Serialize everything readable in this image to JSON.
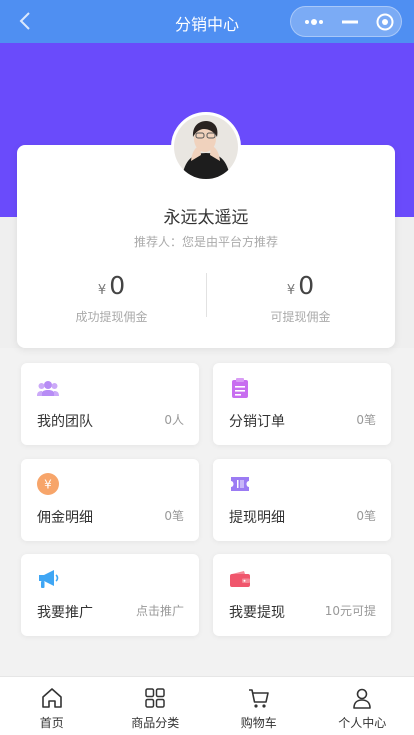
{
  "navbar": {
    "title": "分销中心"
  },
  "profile": {
    "name": "永远太遥远",
    "referrer": "推荐人：您是由平台方推荐",
    "currency": "¥",
    "success_amount": "0",
    "success_label": "成功提现佣金",
    "available_amount": "0",
    "available_label": "可提现佣金"
  },
  "tiles": [
    {
      "label": "我的团队",
      "value": "0人",
      "icon": "team-icon",
      "color": "#b78cf5"
    },
    {
      "label": "分销订单",
      "value": "0笔",
      "icon": "order-list-icon",
      "color": "#c86ef0"
    },
    {
      "label": "佣金明细",
      "value": "0笔",
      "icon": "yen-coin-icon",
      "color": "#f7a56a"
    },
    {
      "label": "提现明细",
      "value": "0笔",
      "icon": "withdraw-ticket-icon",
      "color": "#9b7bf3"
    },
    {
      "label": "我要推广",
      "value": "点击推广",
      "icon": "megaphone-icon",
      "color": "#3fa6f4"
    },
    {
      "label": "我要提现",
      "value": "10元可提",
      "icon": "wallet-icon",
      "color": "#f0566c"
    }
  ],
  "tabbar": [
    {
      "label": "首页",
      "icon": "home-icon"
    },
    {
      "label": "商品分类",
      "icon": "category-grid-icon"
    },
    {
      "label": "购物车",
      "icon": "cart-icon"
    },
    {
      "label": "个人中心",
      "icon": "user-icon"
    }
  ]
}
